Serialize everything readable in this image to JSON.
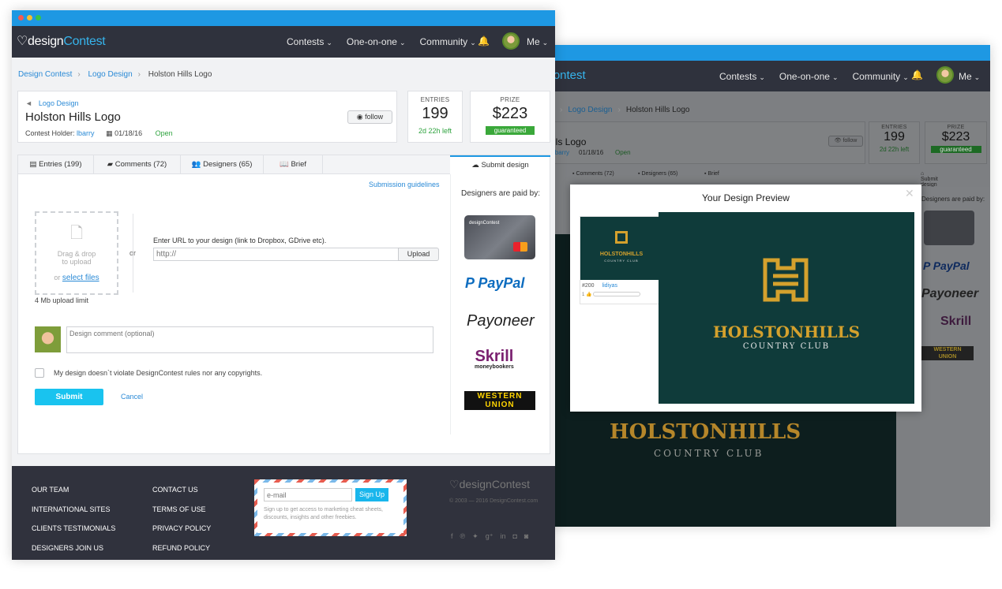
{
  "brand": {
    "logo_prefix": "design",
    "logo_suffix": "Contest"
  },
  "nav": {
    "contests": "Contests",
    "one_on_one": "One-on-one",
    "community": "Community",
    "me": "Me"
  },
  "breadcrumb": {
    "home": "Design Contest",
    "category": "Logo Design",
    "current": "Holston Hills Logo"
  },
  "contest": {
    "category": "Logo Design",
    "title": "Holston Hills Logo",
    "holder_label": "Contest Holder:",
    "holder": "lbarry",
    "date": "01/18/16",
    "status": "Open",
    "follow": "follow",
    "short_title": "lls Logo",
    "short_holder": "lbarry"
  },
  "stats": {
    "entries_label": "ENTRIES",
    "entries": "199",
    "time_left": "2d 22h left",
    "prize_label": "PRIZE",
    "prize": "$223",
    "guaranteed": "guaranteed"
  },
  "tabs": {
    "entries": "Entries (199)",
    "comments": "Comments (72)",
    "designers": "Designers (65)",
    "brief": "Brief",
    "submit": "Submit design"
  },
  "submit": {
    "guidelines": "Submission guidelines",
    "drag": "Drag & drop",
    "to_upload": "to upload",
    "or_select": "or",
    "select_files": "select files",
    "or": "or",
    "limit": "4 Mb upload limit",
    "url_label": "Enter URL to your design (link to Dropbox, GDrive etc).",
    "url_placeholder": "http://",
    "upload": "Upload",
    "comment_placeholder": "Design comment (optional)",
    "rules": "My design doesn`t violate DesignContest rules nor any copyrights.",
    "submit": "Submit",
    "cancel": "Cancel"
  },
  "payments": {
    "title": "Designers are paid by:",
    "paypal": "PayPal",
    "payoneer": "Payoneer",
    "skrill": "Skrill",
    "skrill_sub": "moneybookers",
    "western": "WESTERN",
    "union": "UNION",
    "card_brand": "designContest"
  },
  "footer": {
    "col1": [
      "OUR TEAM",
      "INTERNATIONAL SITES",
      "CLIENTS TESTIMONIALS",
      "DESIGNERS JOIN US"
    ],
    "col2": [
      "CONTACT US",
      "TERMS OF USE",
      "PRIVACY POLICY",
      "REFUND POLICY"
    ],
    "email_placeholder": "e-mail",
    "signup": "Sign Up",
    "signup_note": "Sign up to get access to marketing cheat sheets, discounts, insights and other freebies.",
    "copyright": "© 2003 — 2016 DesignContest.com"
  },
  "preview": {
    "title": "Your Design Preview",
    "entry_no": "#200",
    "entry_user": "lidiyas",
    "brand_top": "HOLSTONHILLS",
    "brand_sub": "COUNTRY CLUB",
    "thumb_count": "1"
  },
  "back_window": {
    "short_tab_comments": "Comments (72)",
    "short_tab_designers": "Designers (65)",
    "short_tab_brief": "Brief"
  },
  "colors": {
    "accent": "#1e98e3",
    "nav_bg": "#2f323d",
    "open": "#2fa33f",
    "guaranteed": "#3aa83a",
    "submit_btn": "#19c3ef",
    "design_bg": "#0f3b3a",
    "gold": "#d4a12d"
  },
  "icons": [
    "eye-icon",
    "bell-icon",
    "caret-down-icon",
    "file-upload-icon",
    "checkbox-icon",
    "facebook-icon",
    "pinterest-icon",
    "twitter-icon",
    "google-plus-icon",
    "linkedin-icon",
    "instagram-icon",
    "rss-icon",
    "close-icon"
  ]
}
